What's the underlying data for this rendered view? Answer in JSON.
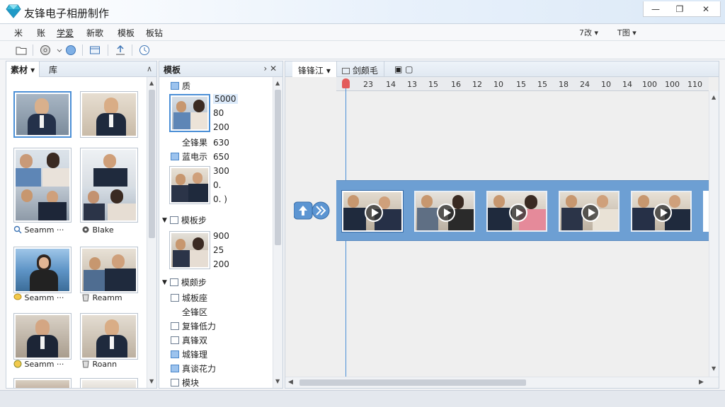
{
  "window": {
    "title": "友锋电子相册制作",
    "controls": {
      "minimize": "—",
      "maximize": "❐",
      "close": "✕"
    }
  },
  "menu": {
    "items": [
      "米",
      "账",
      "学爱",
      "新歌",
      "模板",
      "板钻"
    ],
    "active_index": 2,
    "right_dropdowns": [
      "7改 ▾",
      "T图 ▾"
    ]
  },
  "material_panel": {
    "tabs": [
      "素材 ▾",
      "库"
    ],
    "collapse_glyph": "∧",
    "labels": [
      "Seamm ···",
      "Blake",
      "Seamm ···",
      "Reamm",
      "Seamm ···",
      "Roann"
    ]
  },
  "template_panel": {
    "title": "模板",
    "controls": "› ✕",
    "root_label": "质",
    "numbers_1": [
      "5000",
      "80",
      "200"
    ],
    "items_1": [
      {
        "label": "全锋果",
        "value": "630"
      },
      {
        "label": "蓝电示",
        "value": "650"
      }
    ],
    "numbers_2": [
      "300",
      "0.  ",
      "0. )"
    ],
    "group_1": "模板步",
    "numbers_3": [
      "900",
      "25",
      "200"
    ],
    "group_2": "模颇步",
    "sub_items": [
      "城板座",
      "全锋区",
      "复锋低力",
      "真锋双",
      "城锋理",
      "真谈花力",
      "模块"
    ]
  },
  "timeline_panel": {
    "tabs": [
      "锋锋江 ▾",
      "剑颇毛",
      "▣ ▢"
    ],
    "ruler_ticks": [
      "23",
      "14",
      "13",
      "15",
      "16",
      "12",
      "10",
      "15",
      "15",
      "18",
      "24",
      "10",
      "14",
      "100",
      "100",
      "110"
    ],
    "clip_count": 5
  }
}
